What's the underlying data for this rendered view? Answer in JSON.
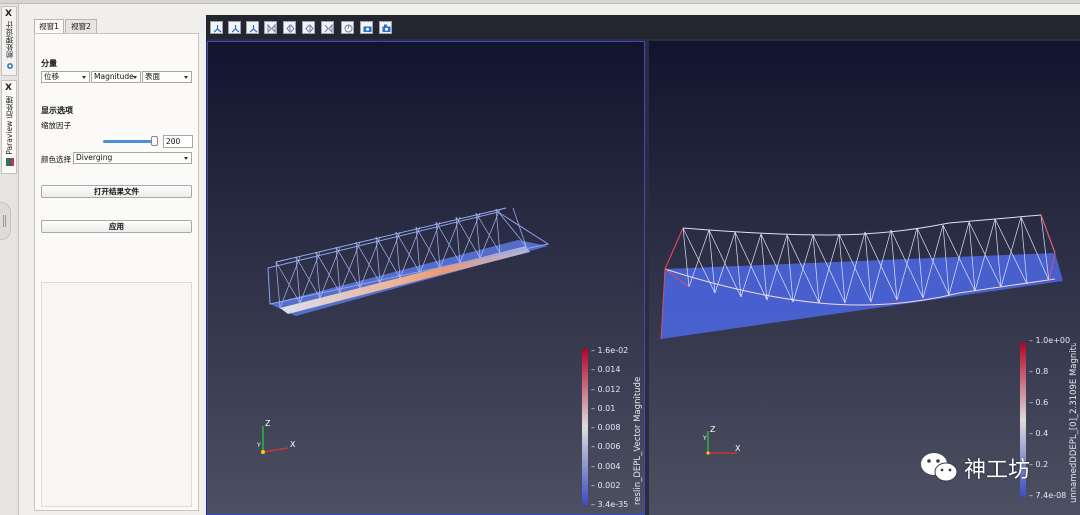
{
  "sidebar_tabs": [
    {
      "close": "X",
      "label": "前处理设计",
      "icon": "gear-icon"
    },
    {
      "close": "X",
      "label": "Paraview 后处理",
      "icon": "paraview-icon"
    }
  ],
  "panel": {
    "tabs": [
      "视窗1",
      "视窗2"
    ],
    "component_title": "分量",
    "combos": {
      "field": "位移",
      "component": "Magnitude",
      "representation": "表面"
    },
    "display_title": "显示选项",
    "scale_label": "缩放因子",
    "scale_value": "200",
    "scale_fraction": 0.95,
    "color_label": "颜色选择",
    "color_value": "Diverging",
    "open_button": "打开结果文件",
    "apply_button": "应用"
  },
  "toolbar": {
    "buttons": [
      "reset-axis-x-icon",
      "reset-axis-y-icon",
      "reset-axis-z-icon",
      "view-neg-x-icon",
      "view-pos-x-icon",
      "view-neg-y-icon",
      "view-pos-y-icon",
      "rotate-icon",
      "camera-icon",
      "camera-settings-icon"
    ]
  },
  "view_left": {
    "colorbar_title": "reslin_DEPL_Vector Magnitude",
    "ticks": [
      "1.6e-02",
      "0.014",
      "0.012",
      "0.01",
      "0.008",
      "0.006",
      "0.004",
      "0.002",
      "3.4e-35"
    ],
    "axes": {
      "z": "Z",
      "y": "Y",
      "x": "X"
    }
  },
  "view_right": {
    "colorbar_title": "unnamedDDEPL_[0]_2.3109E Magnitude",
    "ticks": [
      "1.0e+00",
      "0.8",
      "0.6",
      "0.4",
      "0.2",
      "7.4e-08"
    ],
    "axes": {
      "z": "Z",
      "y": "Y",
      "x": "X"
    }
  },
  "watermark": {
    "text": "神工坊"
  },
  "colors": {
    "accent": "#4b8fd6",
    "cold": "#3b4cc0",
    "hot": "#b40426",
    "bg_top": "#11142e",
    "bg_bottom": "#4d5062"
  }
}
